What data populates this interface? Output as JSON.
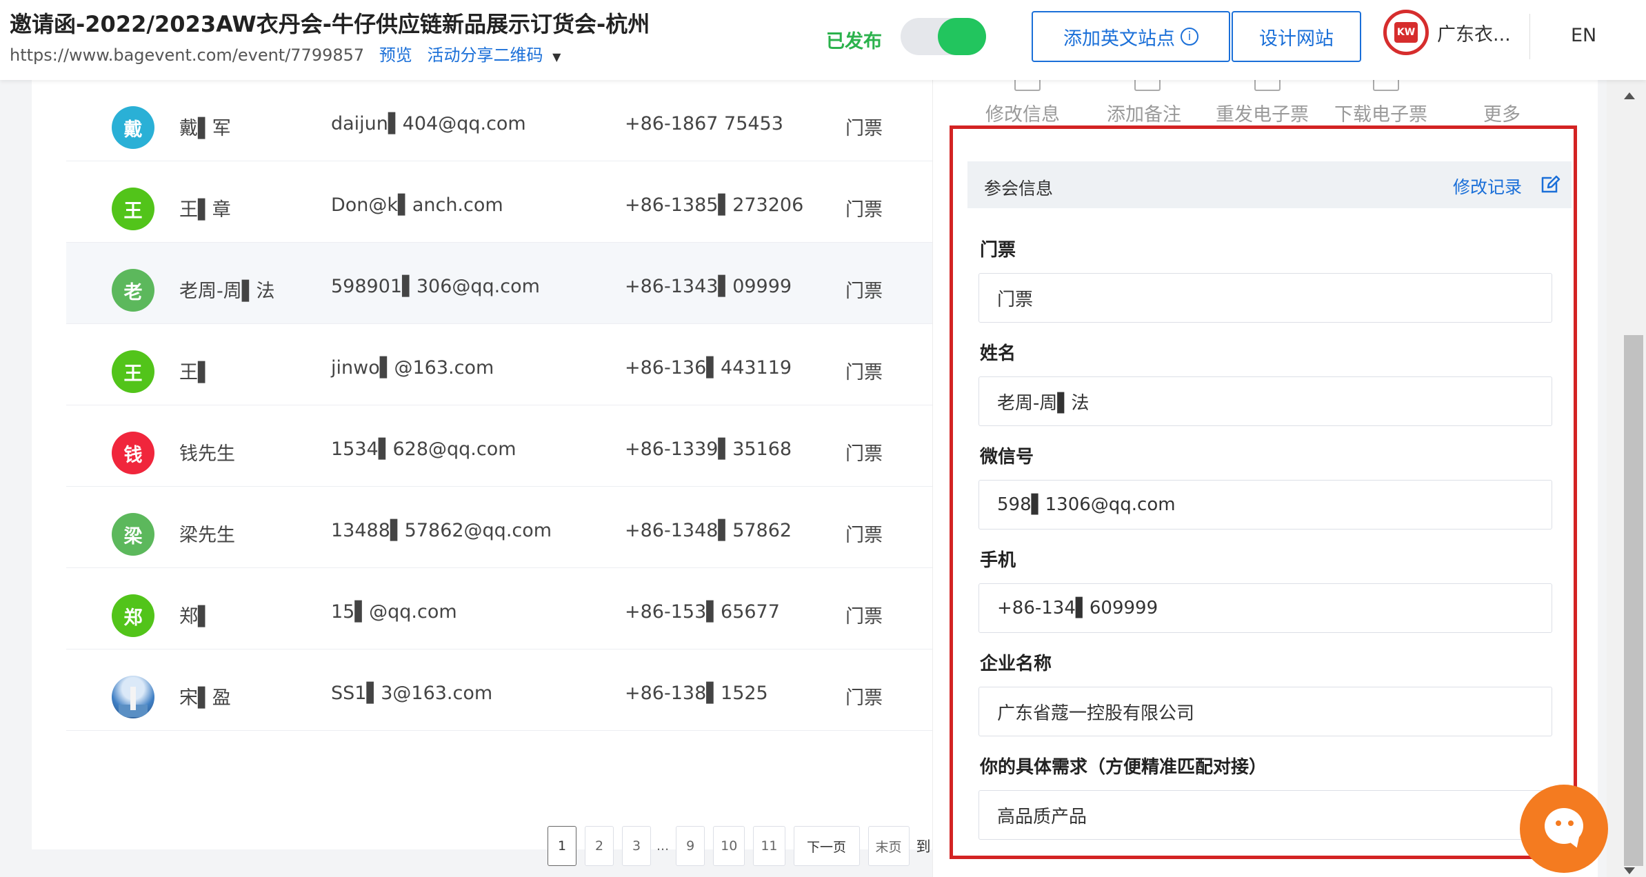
{
  "header": {
    "title": "邀请函-2022/2023AW衣丹会-牛仔供应链新品展示订货会-杭州",
    "url": "https://www.bagevent.com/event/7799857",
    "preview_label": "预览",
    "share_label": "活动分享二维码",
    "published_label": "已发布",
    "add_english_site_label": "添加英文站点",
    "info_icon_text": "i",
    "design_site_label": "设计网站",
    "org_name": "广东衣...",
    "lang_label": "EN"
  },
  "list": {
    "rows": [
      {
        "avatar": "戴",
        "avatar_color": "#2ab0d6",
        "name": "戴▌军",
        "email": "daijun▌404@qq.com",
        "phone": "+86-1867      75453",
        "ticket": "门票"
      },
      {
        "avatar": "王",
        "avatar_color": "#52c41a",
        "name": "王▌章",
        "email": "Don@k▌anch.com",
        "phone": "+86-1385▌273206",
        "ticket": "门票"
      },
      {
        "avatar": "老",
        "avatar_color": "#5cb85c",
        "name": "老周-周▌法",
        "email": "598901▌306@qq.com",
        "phone": "+86-1343▌09999",
        "ticket": "门票"
      },
      {
        "avatar": "王",
        "avatar_color": "#52c41a",
        "name": "王▌",
        "email": "jinwo▌@163.com",
        "phone": "+86-136▌443119",
        "ticket": "门票"
      },
      {
        "avatar": "钱",
        "avatar_color": "#f0263c",
        "name": "钱先生",
        "email": "1534▌628@qq.com",
        "phone": "+86-1339▌35168",
        "ticket": "门票"
      },
      {
        "avatar": "梁",
        "avatar_color": "#5cb85c",
        "name": "梁先生",
        "email": "13488▌57862@qq.com",
        "phone": "+86-1348▌57862",
        "ticket": "门票"
      },
      {
        "avatar": "郑",
        "avatar_color": "#52c41a",
        "name": "郑▌",
        "email": "15▌@qq.com",
        "phone": "+86-153▌65677",
        "ticket": "门票"
      },
      {
        "avatar": "",
        "avatar_color": "#3f7fc4",
        "name": "宋▌盈",
        "email": "SS1▌3@163.com",
        "phone": "+86-138▌1525",
        "ticket": "门票"
      }
    ],
    "pagination": {
      "pages": [
        "1",
        "2",
        "3",
        "9",
        "10",
        "11"
      ],
      "current": "1",
      "ellipsis": "...",
      "next_label": "下一页",
      "last_label": "末页",
      "goto_label": "到"
    }
  },
  "detail": {
    "actions": [
      "修改信息",
      "添加备注",
      "重发电子票",
      "下载电子票",
      "更多"
    ],
    "section_title": "参会信息",
    "history_link": "修改记录",
    "fields": [
      {
        "label": "门票",
        "value": "门票"
      },
      {
        "label": "姓名",
        "value": "老周-周▌法"
      },
      {
        "label": "微信号",
        "value": "598▌1306@qq.com"
      },
      {
        "label": "手机",
        "value": "+86-134▌609999"
      },
      {
        "label": "企业名称",
        "value": "广东省蔻一控股有限公司"
      },
      {
        "label": "你的具体需求（方便精准匹配对接）",
        "value": "高品质产品"
      }
    ]
  },
  "colors": {
    "accent": "#1a6fd8",
    "published": "#2bb24c",
    "highlight_border": "#d32323",
    "chat": "#f47b20"
  },
  "icons": [
    "info-icon",
    "caret-down-icon",
    "edit-icon",
    "chat-icon",
    "scroll-up-icon",
    "scroll-down-icon"
  ]
}
